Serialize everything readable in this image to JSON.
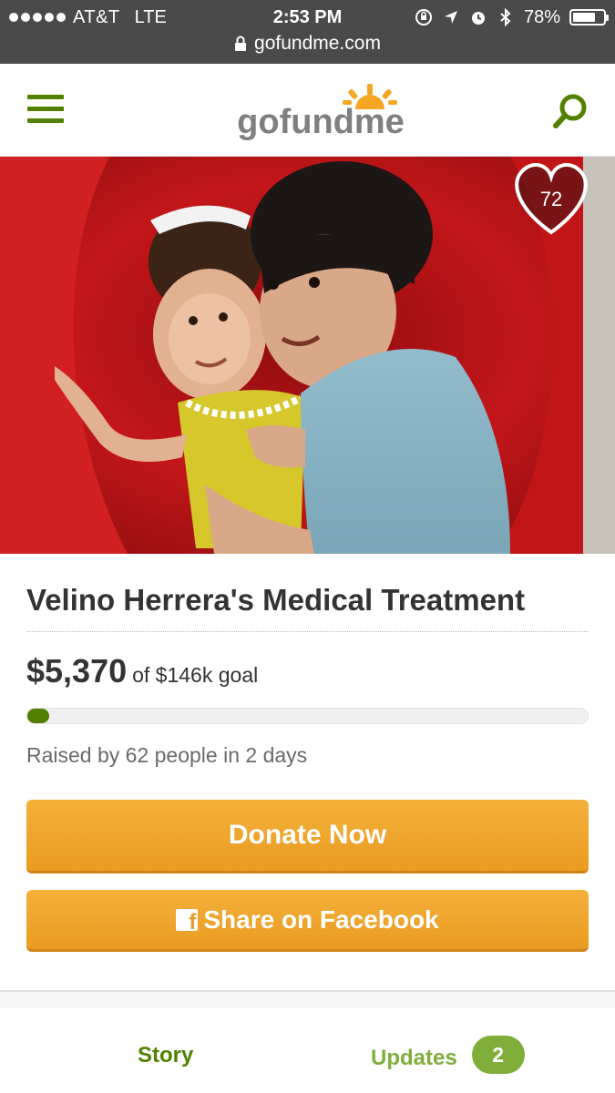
{
  "status_bar": {
    "carrier": "AT&T",
    "network": "LTE",
    "time": "2:53 PM",
    "battery": "78%",
    "battery_level": 0.78,
    "url": "gofundme.com"
  },
  "header": {
    "logo_text": "gofundme",
    "logo_colors": {
      "go": "#8c8c8c",
      "fund": "#8c8c8c",
      "me": "#8c8c8c",
      "sun": "#f5a623"
    },
    "menu_icon": "hamburger-icon",
    "search_icon": "search-icon"
  },
  "hero": {
    "hearts_count": "72"
  },
  "campaign": {
    "title": "Velino Herrera's Medical Treatment",
    "raised": "$5,370",
    "goal_text": "of $146k goal",
    "progress_fraction": 0.037,
    "raised_by": "Raised by 62 people in 2 days"
  },
  "buttons": {
    "donate": "Donate Now",
    "share": "Share on Facebook"
  },
  "tabs": {
    "story": "Story",
    "updates": "Updates",
    "updates_count": "2"
  },
  "colors": {
    "brand_green": "#528001",
    "light_green": "#7fae3a",
    "button_orange": "#f0a52e",
    "status_bar": "#4a4a4a"
  }
}
